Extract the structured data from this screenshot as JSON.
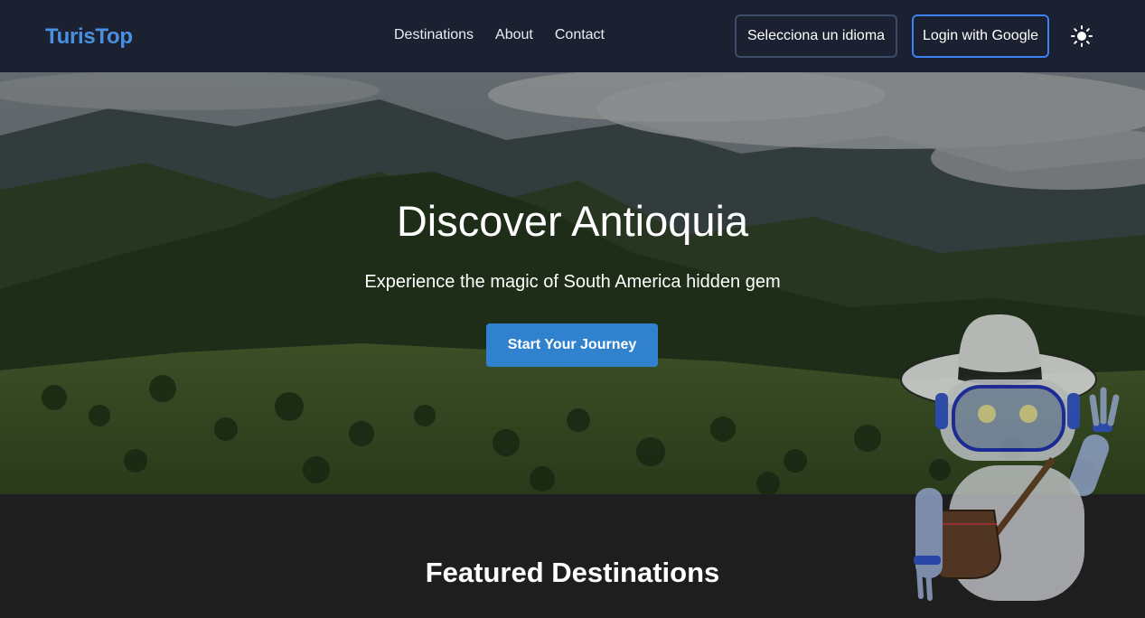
{
  "brand": {
    "logo": "TurisTop"
  },
  "nav": {
    "links": [
      {
        "label": "Destinations"
      },
      {
        "label": "About"
      },
      {
        "label": "Contact"
      }
    ],
    "language_button": "Selecciona un idioma",
    "login_button": "Login with Google",
    "theme_icon": "sun-icon"
  },
  "hero": {
    "title": "Discover Antioquia",
    "subtitle": "Experience the magic of South America hidden gem",
    "cta": "Start Your Journey"
  },
  "featured": {
    "title": "Featured Destinations"
  },
  "colors": {
    "navbar_bg": "#1b2130",
    "brand": "#4a90e2",
    "accent": "#3182ce",
    "login_border": "#3b82f6",
    "page_bg": "#1e1e1e"
  }
}
